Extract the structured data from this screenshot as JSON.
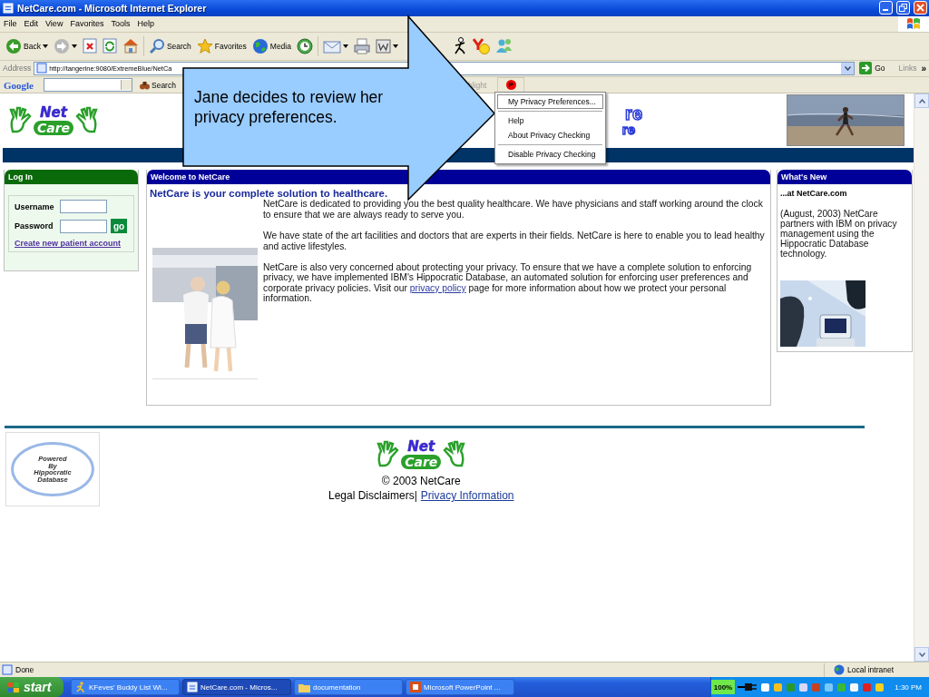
{
  "window": {
    "title": "NetCare.com - Microsoft Internet Explorer"
  },
  "menu_bar": [
    "File",
    "Edit",
    "View",
    "Favorites",
    "Tools",
    "Help"
  ],
  "toolbar": [
    {
      "kind": "back",
      "label": "Back",
      "dropdown": true
    },
    {
      "kind": "forward",
      "dropdown": true
    },
    {
      "kind": "stop"
    },
    {
      "kind": "refresh"
    },
    {
      "kind": "home"
    },
    {
      "kind": "search",
      "label": "Search"
    },
    {
      "kind": "favorites",
      "label": "Favorites"
    },
    {
      "kind": "media",
      "label": "Media"
    },
    {
      "kind": "history"
    },
    {
      "kind": "mail",
      "dropdown": true
    },
    {
      "kind": "print"
    },
    {
      "kind": "edit",
      "dropdown": true
    },
    {
      "kind": "runner"
    },
    {
      "kind": "smiley"
    },
    {
      "kind": "people"
    }
  ],
  "address": {
    "label": "Address",
    "url": "http://tangerine:9080/ExtremeBlue/NetCa",
    "go": "Go",
    "links": "Links",
    "more": "»"
  },
  "google_bar": {
    "logo": "Google",
    "search": "Search",
    "highlight": "hlight",
    "privacy_button": "P"
  },
  "privacy_menu": [
    {
      "kind": "item",
      "label": "My Privacy Preferences...",
      "selected": true
    },
    {
      "kind": "separator"
    },
    {
      "kind": "item",
      "label": "Help",
      "selected": false
    },
    {
      "kind": "item",
      "label": "About Privacy Checking",
      "selected": false
    },
    {
      "kind": "separator"
    },
    {
      "kind": "item",
      "label": "Disable Privacy Checking",
      "selected": false
    }
  ],
  "callout": {
    "text": "Jane decides to review her privacy preferences."
  },
  "header_logo": {
    "line1": "Net",
    "line2": "Care"
  },
  "banner_fragments": [
    "re",
    "re"
  ],
  "login": {
    "title": "Log In",
    "fields": [
      {
        "label": "Username",
        "kind": "text"
      },
      {
        "label": "Password",
        "kind": "password"
      }
    ],
    "go": "go",
    "link": "Create new patient account"
  },
  "welcome": {
    "title": "Welcome to NetCare",
    "heading": "NetCare is your complete solution to healthcare.",
    "paragraphs": [
      {
        "text": "NetCare is dedicated to providing you the best quality healthcare. We have physicians and staff working around the clock to ensure that we are always ready to serve you."
      },
      {
        "text": "We have state of the art facilities and doctors that are experts in their fields. NetCare is here to enable you to lead healthy and active lifestyles."
      },
      {
        "text": "NetCare is also very concerned about protecting your privacy. To ensure that we have a complete solution to enforcing privacy, we have implemented IBM's Hippocratic Database, an automated solution for enforcing user preferences and corporate privacy policies. Visit our",
        "link": "privacy policy",
        "after": "page for more information about how we protect your personal information."
      }
    ]
  },
  "whats_new": {
    "title": "What's New",
    "subtitle": "...at NetCare.com",
    "text": "(August, 2003) NetCare partners with IBM on privacy management using the Hippocratic Database technology."
  },
  "powered_logo": [
    "Powered",
    "By",
    "Hippocratic",
    "Database"
  ],
  "footer_logo": {
    "line1": "Net",
    "line2": "Care"
  },
  "footer": {
    "copyright": "© 2003 NetCare",
    "disclaimer": "Legal Disclaimers|",
    "privacy_link": "Privacy Information"
  },
  "status_bar": {
    "text": "Done",
    "zone": "Local intranet"
  },
  "taskbar": {
    "start": "start",
    "tasks": [
      {
        "kind": "buddy",
        "label": "KFeves' Buddy List Wi...",
        "selected": false
      },
      {
        "kind": "browser",
        "label": "NetCare.com - Micros...",
        "selected": true
      },
      {
        "kind": "folder",
        "label": "documentation",
        "selected": false
      },
      {
        "kind": "slides",
        "label": "Microsoft PowerPoint ...",
        "selected": false
      }
    ],
    "battery": "100%",
    "clock": "1:30 PM"
  }
}
